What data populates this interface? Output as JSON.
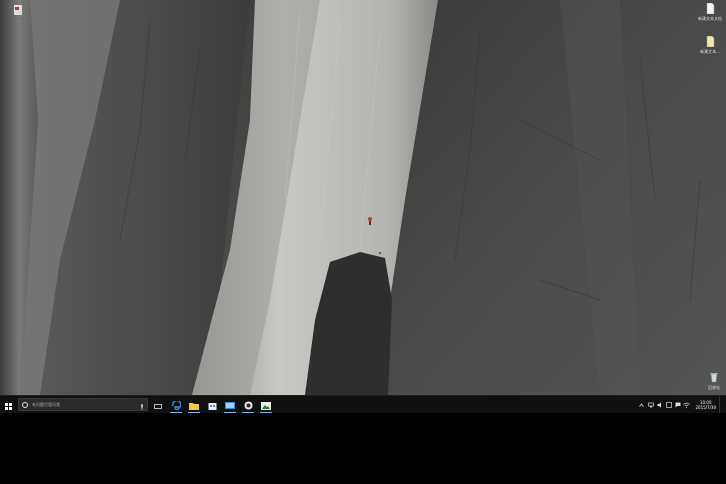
{
  "desktop": {
    "wallpaper": "rock-cliff-with-climber",
    "icons": [
      {
        "label": "...",
        "icon": "app-icon"
      },
      {
        "label": "新建文本文档",
        "icon": "document-icon"
      },
      {
        "label": "新建文本...",
        "icon": "document-icon"
      },
      {
        "label": "回收站",
        "icon": "recycle-bin-icon"
      }
    ]
  },
  "taskbar": {
    "start_icon": "windows-logo-icon",
    "search": {
      "placeholder": "有问题尽管问我"
    },
    "pinned_apps": [
      {
        "name": "task-view",
        "icon": "task-view-icon"
      },
      {
        "name": "edge",
        "icon": "edge-icon",
        "active": true
      },
      {
        "name": "file-explorer",
        "icon": "folder-icon",
        "active": true
      },
      {
        "name": "store",
        "icon": "store-icon"
      },
      {
        "name": "settings",
        "icon": "settings-icon",
        "active": true
      },
      {
        "name": "app",
        "icon": "app-icon",
        "active": true
      },
      {
        "name": "photos",
        "icon": "photos-icon",
        "active": true
      }
    ],
    "tray": {
      "icons": [
        "chevron-up-icon",
        "network-icon",
        "volume-icon",
        "ime-icon",
        "notification-icon",
        "wifi-icon"
      ],
      "time": "10:00",
      "date": "2015/7/30"
    }
  },
  "colors": {
    "taskbar_bg": "#101010",
    "accent": "#7db7f0"
  }
}
